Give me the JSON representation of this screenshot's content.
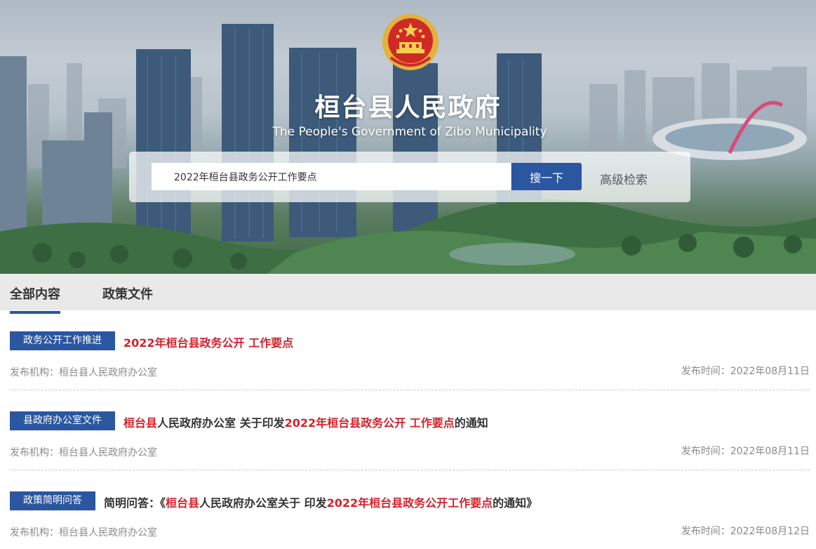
{
  "site": {
    "title": "桓台县人民政府",
    "subtitle": "The People's Government of Zibo Municipality"
  },
  "search": {
    "value": "2022年桓台县政务公开工作要点",
    "button_label": "搜一下",
    "advanced_label": "高级检索"
  },
  "tabs": [
    {
      "label": "全部内容",
      "active": true
    },
    {
      "label": "政策文件",
      "active": false
    }
  ],
  "results": [
    {
      "tag": "政务公开工作推进",
      "title_parts": [
        {
          "text": "2022年桓台县政务公开 工作要点",
          "highlight": true
        }
      ],
      "org": "发布机构：桓台县人民政府办公室",
      "date": "发布时间：2022年08月11日"
    },
    {
      "tag": "县政府办公室文件",
      "title_parts": [
        {
          "text": "桓台县",
          "highlight": true
        },
        {
          "text": "人民政府办公室 关于印发",
          "highlight": false
        },
        {
          "text": "2022年桓台县政务公开 工作要点",
          "highlight": true
        },
        {
          "text": "的通知",
          "highlight": false
        }
      ],
      "org": "发布机构：桓台县人民政府办公室",
      "date": "发布时间：2022年08月11日"
    },
    {
      "tag": "政策简明问答",
      "title_parts": [
        {
          "text": "简明问答：《",
          "highlight": false
        },
        {
          "text": "桓台县",
          "highlight": true
        },
        {
          "text": "人民政府办公室关于 印发",
          "highlight": false
        },
        {
          "text": "2022年桓台县政务公开工作要点",
          "highlight": true
        },
        {
          "text": "的通知》",
          "highlight": false
        }
      ],
      "org": "发布机构：桓台县人民政府办公室",
      "date": "发布时间：2022年08月12日"
    }
  ],
  "colors": {
    "accent": "#2b56a0",
    "highlight": "#d3232a",
    "meta": "#8a8a8a"
  },
  "icons": {
    "emblem": "national-emblem-icon"
  }
}
